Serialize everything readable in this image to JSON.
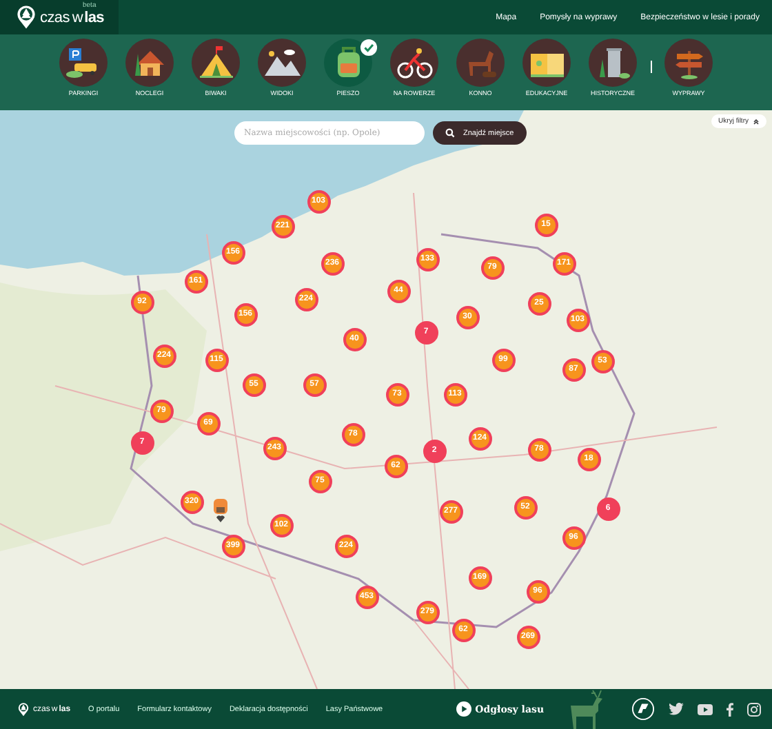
{
  "header": {
    "logo": {
      "text_light": "czas",
      "text_w": "w",
      "text_bold": "las",
      "badge": "beta"
    },
    "nav": [
      "Mapa",
      "Pomysły na wyprawy",
      "Bezpieczeństwo w lesie i porady"
    ]
  },
  "categories": [
    {
      "label": "PARKINGI",
      "selected": false
    },
    {
      "label": "NOCLEGI",
      "selected": false
    },
    {
      "label": "BIWAKI",
      "selected": false
    },
    {
      "label": "WIDOKI",
      "selected": false
    },
    {
      "label": "PIESZO",
      "selected": true
    },
    {
      "label": "NA ROWERZE",
      "selected": false
    },
    {
      "label": "KONNO",
      "selected": false
    },
    {
      "label": "EDUKACYJNE",
      "selected": false
    },
    {
      "label": "HISTORYCZNE",
      "selected": false
    },
    {
      "label": "WYPRAWY",
      "selected": false
    }
  ],
  "search": {
    "placeholder": "Nazwa miejscowości (np. Opole)",
    "button": "Znajdź miejsce"
  },
  "hide_filters": "Ukryj filtry",
  "clusters": [
    {
      "count": "103",
      "color": "#f7941d"
    },
    {
      "count": "221",
      "color": "#f7941d"
    },
    {
      "count": "156",
      "color": "#f7941d"
    },
    {
      "count": "236",
      "color": "#f7941d"
    },
    {
      "count": "161",
      "color": "#f7941d"
    },
    {
      "count": "92",
      "color": "#f7941d"
    },
    {
      "count": "224",
      "color": "#f7941d"
    },
    {
      "count": "156",
      "color": "#f7941d"
    },
    {
      "count": "40",
      "color": "#f7941d"
    },
    {
      "count": "224",
      "color": "#f7941d"
    },
    {
      "count": "115",
      "color": "#f7941d"
    },
    {
      "count": "55",
      "color": "#f7941d"
    },
    {
      "count": "57",
      "color": "#f7941d"
    },
    {
      "count": "79",
      "color": "#f7941d"
    },
    {
      "count": "69",
      "color": "#f7941d"
    },
    {
      "count": "7",
      "color": "#f0405a"
    },
    {
      "count": "243",
      "color": "#f7941d"
    },
    {
      "count": "78",
      "color": "#f7941d"
    },
    {
      "count": "62",
      "color": "#f7941d"
    },
    {
      "count": "2",
      "color": "#f0405a"
    },
    {
      "count": "124",
      "color": "#f7941d"
    },
    {
      "count": "78",
      "color": "#f7941d"
    },
    {
      "count": "18",
      "color": "#f7941d"
    },
    {
      "count": "75",
      "color": "#f7941d"
    },
    {
      "count": "320",
      "color": "#f7941d"
    },
    {
      "count": "277",
      "color": "#f7941d"
    },
    {
      "count": "52",
      "color": "#f7941d"
    },
    {
      "count": "6",
      "color": "#f0405a"
    },
    {
      "count": "102",
      "color": "#f7941d"
    },
    {
      "count": "96",
      "color": "#f7941d"
    },
    {
      "count": "399",
      "color": "#f7941d"
    },
    {
      "count": "224",
      "color": "#f7941d"
    },
    {
      "count": "169",
      "color": "#f7941d"
    },
    {
      "count": "96",
      "color": "#f7941d"
    },
    {
      "count": "453",
      "color": "#f7941d"
    },
    {
      "count": "279",
      "color": "#f7941d"
    },
    {
      "count": "62",
      "color": "#f7941d"
    },
    {
      "count": "269",
      "color": "#f7941d"
    },
    {
      "count": "15",
      "color": "#f7941d"
    },
    {
      "count": "133",
      "color": "#f7941d"
    },
    {
      "count": "79",
      "color": "#f7941d"
    },
    {
      "count": "171",
      "color": "#f7941d"
    },
    {
      "count": "44",
      "color": "#f7941d"
    },
    {
      "count": "25",
      "color": "#f7941d"
    },
    {
      "count": "30",
      "color": "#f7941d"
    },
    {
      "count": "103",
      "color": "#f7941d"
    },
    {
      "count": "7",
      "color": "#f0405a"
    },
    {
      "count": "99",
      "color": "#f7941d"
    },
    {
      "count": "87",
      "color": "#f7941d"
    },
    {
      "count": "53",
      "color": "#f7941d"
    },
    {
      "count": "73",
      "color": "#f7941d"
    },
    {
      "count": "113",
      "color": "#f7941d"
    }
  ],
  "footer": {
    "logo": {
      "text_light": "czas",
      "text_w": "w",
      "text_bold": "las"
    },
    "links": [
      "O portalu",
      "Formularz kontaktowy",
      "Deklaracja dostępności",
      "Lasy Państwowe"
    ],
    "sounds": "Odgłosy lasu"
  }
}
